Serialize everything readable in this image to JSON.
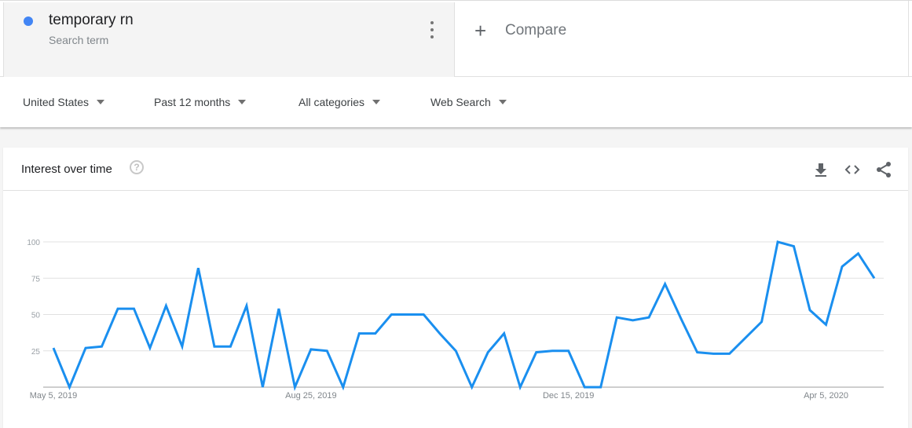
{
  "search": {
    "term": "temporary rn",
    "term_type": "Search term",
    "term_color": "#4285f4",
    "menu_icon": "more-vert-icon",
    "compare_icon": "plus-icon",
    "compare_label": "Compare"
  },
  "filters": [
    {
      "label": "United States",
      "icon": "caret-down-icon"
    },
    {
      "label": "Past 12 months",
      "icon": "caret-down-icon"
    },
    {
      "label": "All categories",
      "icon": "caret-down-icon"
    },
    {
      "label": "Web Search",
      "icon": "caret-down-icon"
    }
  ],
  "card": {
    "title": "Interest over time",
    "help_icon": "help-icon",
    "help_glyph": "?",
    "actions": [
      "download-icon",
      "embed-code-icon",
      "share-icon"
    ]
  },
  "colors": {
    "line": "#1a8fef",
    "grid": "#e0e0e0",
    "axis": "#9e9e9e"
  },
  "chart_data": {
    "type": "line",
    "title": "Interest over time",
    "xlabel": "",
    "ylabel": "",
    "ylim": [
      0,
      100
    ],
    "yticks": [
      25,
      50,
      75,
      100
    ],
    "grid": true,
    "x_tick_labels": [
      {
        "index": 0,
        "label": "May 5, 2019"
      },
      {
        "index": 16,
        "label": "Aug 25, 2019"
      },
      {
        "index": 32,
        "label": "Dec 15, 2019"
      },
      {
        "index": 48,
        "label": "Apr 5, 2020"
      }
    ],
    "x_interval": "weekly",
    "series": [
      {
        "name": "temporary rn",
        "values": [
          27,
          0,
          27,
          28,
          54,
          54,
          27,
          56,
          28,
          82,
          28,
          28,
          56,
          0,
          54,
          0,
          26,
          25,
          0,
          37,
          37,
          50,
          50,
          50,
          37,
          25,
          0,
          24,
          37,
          0,
          24,
          25,
          25,
          0,
          0,
          48,
          46,
          48,
          71,
          47,
          24,
          23,
          23,
          34,
          45,
          100,
          97,
          53,
          43,
          83,
          92,
          75
        ]
      }
    ]
  }
}
